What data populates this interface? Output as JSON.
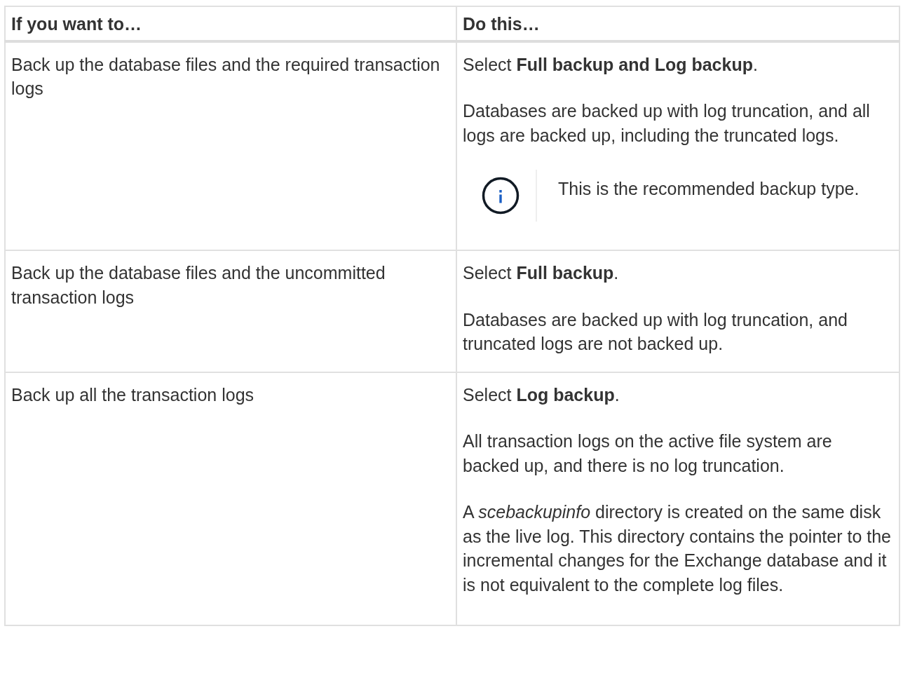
{
  "table": {
    "columns": [
      "If you want to…",
      "Do this…"
    ],
    "rows": [
      {
        "want": "Back up the database files and the required transaction logs",
        "do": [
          {
            "kind": "para",
            "text": "Select **Full backup and Log backup**."
          },
          {
            "kind": "para",
            "text": "Databases are backed up with log truncation, and all logs are backed up, including the truncated logs."
          },
          {
            "kind": "note",
            "text": "This is the recommended backup type."
          }
        ]
      },
      {
        "want": "Back up the database files and the uncommitted transaction logs",
        "do": [
          {
            "kind": "para",
            "text": "Select **Full backup**."
          },
          {
            "kind": "para",
            "text": "Databases are backed up with log truncation, and truncated logs are not backed up."
          }
        ]
      },
      {
        "want": "Back up all the transaction logs",
        "do": [
          {
            "kind": "para",
            "text": "Select **Log backup**."
          },
          {
            "kind": "para",
            "text": "All transaction logs on the active file system are backed up, and there is no log truncation."
          },
          {
            "kind": "para",
            "text": "A *scebackupinfo* directory is created on the same disk as the live log. This directory contains the pointer to the incremental changes for the Exchange database and it is not equivalent to the complete log files."
          }
        ]
      }
    ]
  }
}
